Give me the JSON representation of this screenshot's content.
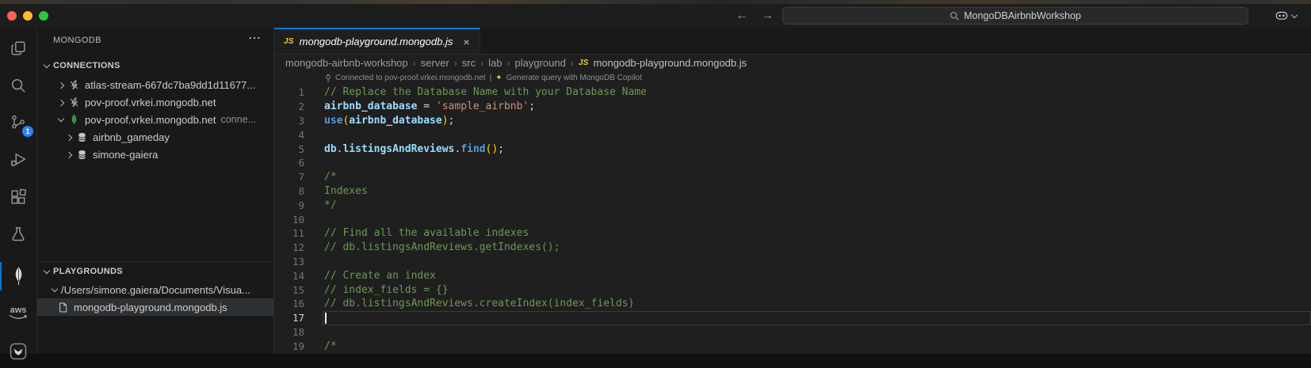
{
  "titlebar": {
    "search_value": "MongoDBAirbnbWorkshop"
  },
  "activity_bar": {
    "scm_badge": "1",
    "aws_label": "aws",
    "items": [
      {
        "name": "explorer"
      },
      {
        "name": "search"
      },
      {
        "name": "source-control",
        "badge": "1"
      },
      {
        "name": "run-and-debug"
      },
      {
        "name": "extensions"
      },
      {
        "name": "testing"
      },
      {
        "name": "mongodb",
        "active": true
      },
      {
        "name": "aws"
      },
      {
        "name": "bird-extension"
      }
    ]
  },
  "sidebar": {
    "title": "MONGODB",
    "connections": {
      "label": "CONNECTIONS",
      "items": [
        {
          "label": "atlas-stream-667dc7ba9dd1d11677...",
          "icon": "disconnected",
          "state": "collapsed"
        },
        {
          "label": "pov-proof.vrkei.mongodb.net",
          "icon": "disconnected",
          "state": "collapsed"
        },
        {
          "label": "pov-proof.vrkei.mongodb.net",
          "suffix": "conne...",
          "icon": "leaf",
          "state": "expanded"
        },
        {
          "label": "airbnb_gameday",
          "icon": "database",
          "state": "collapsed"
        },
        {
          "label": "simone-gaiera",
          "icon": "database",
          "state": "collapsed"
        }
      ]
    },
    "playgrounds": {
      "label": "PLAYGROUNDS",
      "items": [
        {
          "label": "/Users/simone.gaiera/Documents/Visua...",
          "state": "expanded"
        },
        {
          "label": "mongodb-playground.mongodb.js",
          "icon": "file",
          "selected": true
        }
      ]
    }
  },
  "editor": {
    "tab": {
      "badge": "JS",
      "label": "mongodb-playground.mongodb.js"
    },
    "breadcrumbs": [
      "mongodb-airbnb-workshop",
      "server",
      "src",
      "lab",
      "playground"
    ],
    "breadcrumb_separator": "›",
    "breadcrumb_file": {
      "badge": "JS",
      "label": "mongodb-playground.mongodb.js"
    },
    "codelens": {
      "connected": "Connected to pov-proof.vrkei.mongodb.net",
      "separator": "|",
      "copilot": "Generate query with MongoDB Copilot"
    },
    "current_line": 17,
    "lines": [
      {
        "n": 1,
        "tokens": [
          [
            "// Replace the Database Name with your Database Name",
            "comment"
          ]
        ]
      },
      {
        "n": 2,
        "tokens": [
          [
            "airbnb_database",
            "var"
          ],
          [
            " = ",
            "punc"
          ],
          [
            "'sample_airbnb'",
            "str"
          ],
          [
            ";",
            "punc"
          ]
        ]
      },
      {
        "n": 3,
        "tokens": [
          [
            "use",
            "fn"
          ],
          [
            "(",
            "paren"
          ],
          [
            "airbnb_database",
            "var"
          ],
          [
            ")",
            "paren"
          ],
          [
            ";",
            "punc"
          ]
        ]
      },
      {
        "n": 4,
        "tokens": []
      },
      {
        "n": 5,
        "tokens": [
          [
            "db",
            "var"
          ],
          [
            ".",
            "punc"
          ],
          [
            "listingsAndReviews",
            "var"
          ],
          [
            ".",
            "punc"
          ],
          [
            "find",
            "fn"
          ],
          [
            "()",
            "paren"
          ],
          [
            ";",
            "punc"
          ]
        ]
      },
      {
        "n": 6,
        "tokens": []
      },
      {
        "n": 7,
        "tokens": [
          [
            "/*",
            "comment"
          ]
        ]
      },
      {
        "n": 8,
        "tokens": [
          [
            "Indexes",
            "comment"
          ]
        ]
      },
      {
        "n": 9,
        "tokens": [
          [
            "*/",
            "comment"
          ]
        ]
      },
      {
        "n": 10,
        "tokens": []
      },
      {
        "n": 11,
        "tokens": [
          [
            "// Find all the available indexes",
            "comment"
          ]
        ]
      },
      {
        "n": 12,
        "tokens": [
          [
            "// db.listingsAndReviews.getIndexes();",
            "comment"
          ]
        ]
      },
      {
        "n": 13,
        "tokens": []
      },
      {
        "n": 14,
        "tokens": [
          [
            "// Create an index",
            "comment"
          ]
        ]
      },
      {
        "n": 15,
        "tokens": [
          [
            "// index_fields = {}",
            "comment"
          ]
        ]
      },
      {
        "n": 16,
        "tokens": [
          [
            "// db.listingsAndReviews.createIndex(index_fields)",
            "comment"
          ]
        ]
      },
      {
        "n": 17,
        "tokens": []
      },
      {
        "n": 18,
        "tokens": []
      },
      {
        "n": 19,
        "tokens": [
          [
            "/*",
            "comment"
          ]
        ]
      }
    ]
  },
  "colors": {
    "accent": "#0078d4",
    "scm_badge": "#2f81f7",
    "leaf_green": "#47A248",
    "js_yellow": "#e8d22e",
    "comment": "#6A9955",
    "variable": "#9CDCFE",
    "string": "#CE9178",
    "function": "#569CD6",
    "bracket": "#FFD700",
    "traffic_red": "#ff5f57",
    "traffic_yellow": "#febc2e",
    "traffic_green": "#28c840"
  }
}
